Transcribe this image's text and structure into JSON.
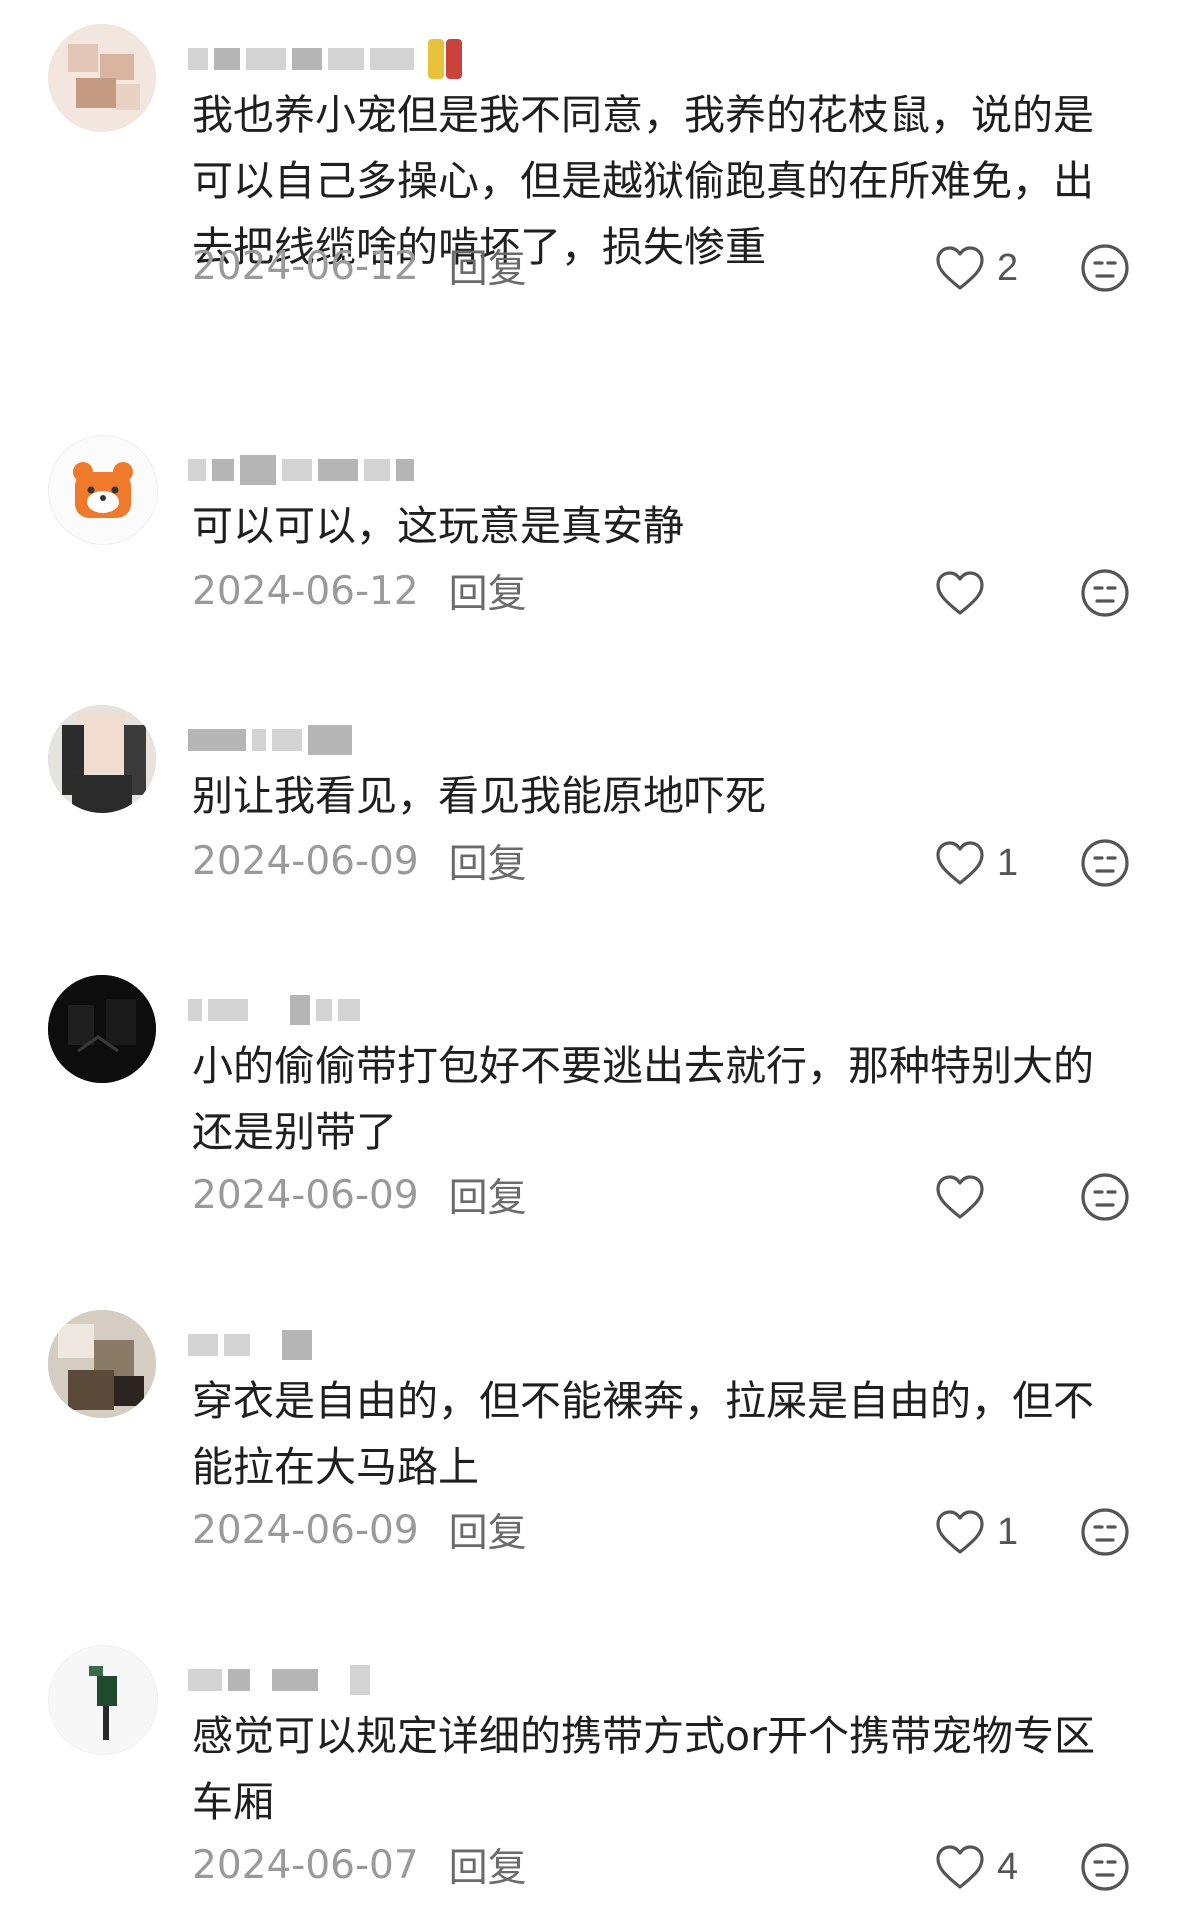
{
  "comments": [
    {
      "text": "我也养小宠但是我不同意，我养的花枝鼠，说的是\n可以自己多操心，但是越狱偷跑真的在所难免，出\n去把线缆啥的啃坏了，损失惨重",
      "date": "2024-06-12",
      "reply": "回复",
      "likes": "2"
    },
    {
      "text": "可以可以，这玩意是真安静",
      "date": "2024-06-12",
      "reply": "回复",
      "likes": ""
    },
    {
      "text": "别让我看见，看见我能原地吓死",
      "date": "2024-06-09",
      "reply": "回复",
      "likes": "1"
    },
    {
      "text": "小的偷偷带打包好不要逃出去就行，那种特别大的\n还是别带了",
      "date": "2024-06-09",
      "reply": "回复",
      "likes": ""
    },
    {
      "text": "穿衣是自由的，但不能裸奔，拉屎是自由的，但不\n能拉在大马路上",
      "date": "2024-06-09",
      "reply": "回复",
      "likes": "1"
    },
    {
      "text": "感觉可以规定详细的携带方式or开个携带宠物专区\n车厢",
      "date": "2024-06-07",
      "reply": "回复",
      "likes": "4"
    }
  ],
  "icons": {
    "like": "heart-outline-icon",
    "reaction": "neutral-face-icon"
  },
  "colors": {
    "text": "#1f1f1f",
    "meta": "#9a9a9a",
    "icon": "#555555",
    "bear_avatar": "#f07a2c"
  }
}
